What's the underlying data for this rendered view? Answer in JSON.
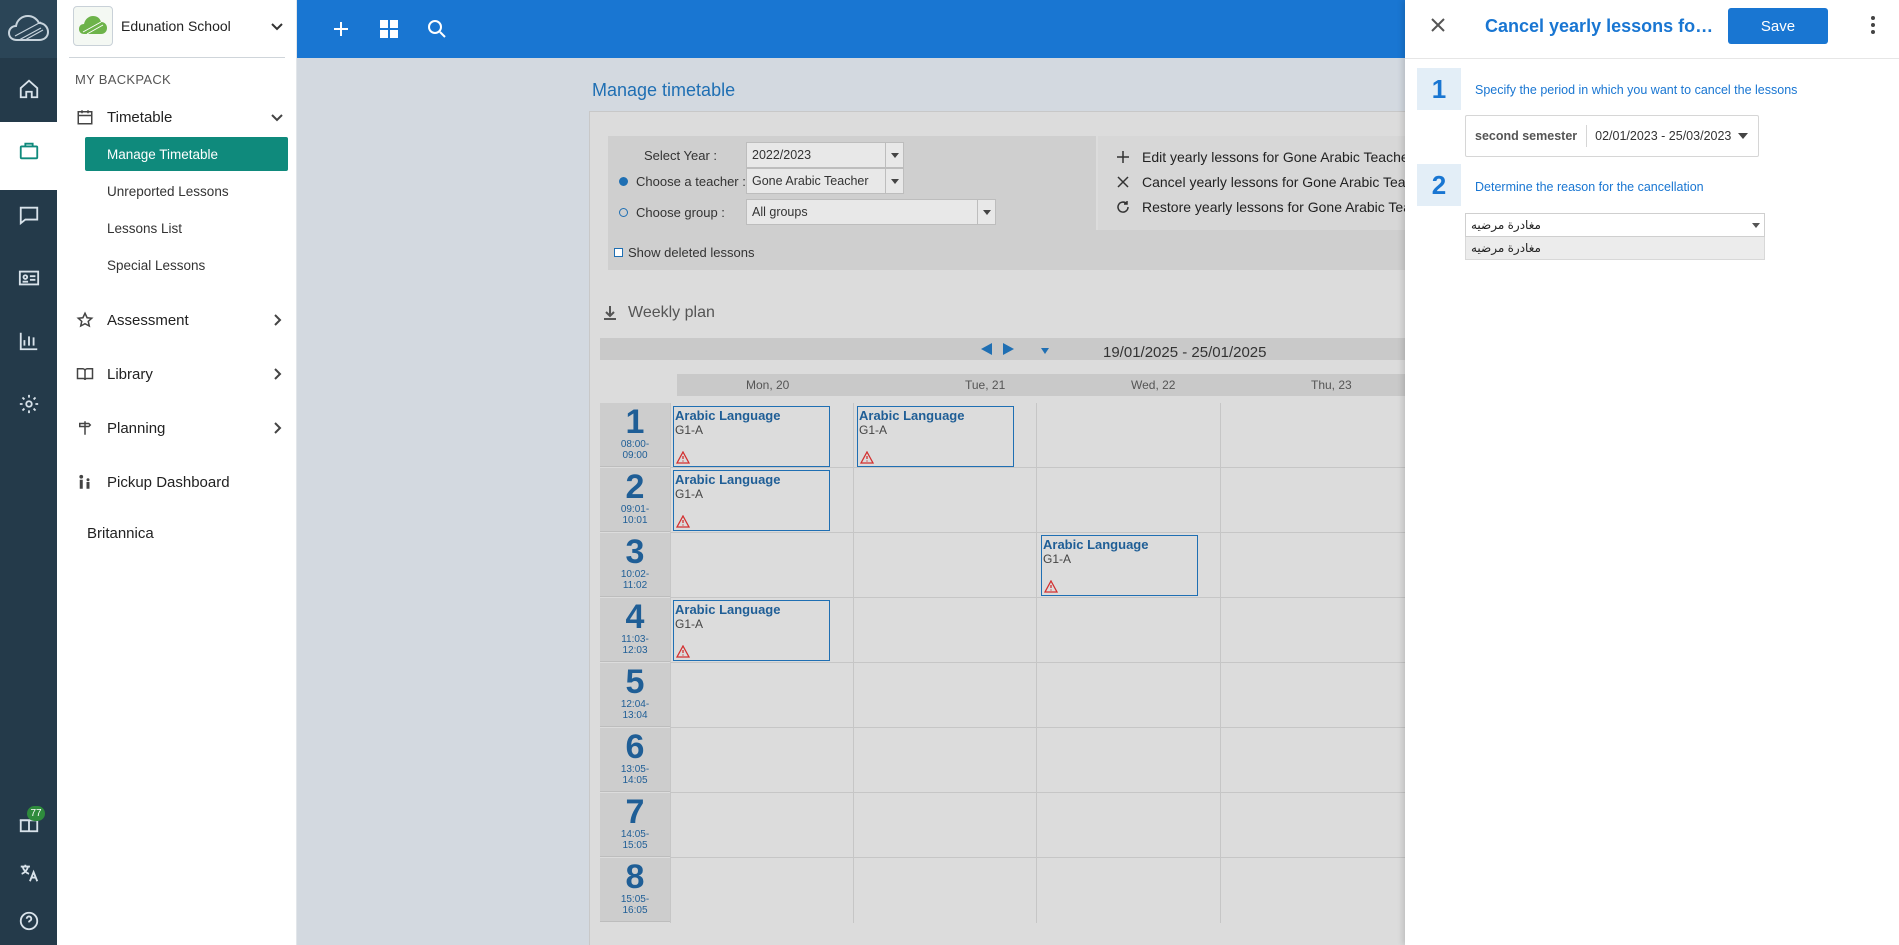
{
  "sidebar": {
    "school_name": "Edunation School",
    "section_header": "MY BACKPACK",
    "timetable_label": "Timetable",
    "sub_items": [
      "Manage Timetable",
      "Unreported Lessons",
      "Lessons List",
      "Special Lessons"
    ],
    "assessment_label": "Assessment",
    "library_label": "Library",
    "planning_label": "Planning",
    "pickup_label": "Pickup Dashboard",
    "britannica_label": "Britannica"
  },
  "rail": {
    "gift_badge": "77"
  },
  "main": {
    "page_title": "Manage timetable",
    "filters": {
      "year_label": "Select Year :",
      "year_value": "2022/2023",
      "teacher_label": "Choose a teacher :",
      "teacher_value": "Gone Arabic Teacher",
      "group_label": "Choose group :",
      "group_value": "All groups",
      "show_deleted": "Show deleted lessons"
    },
    "actions": [
      "Edit yearly lessons for Gone Arabic Teacher",
      "Cancel yearly lessons for Gone Arabic Teacher",
      "Restore yearly lessons for Gone Arabic Teacher"
    ],
    "weekly_plan_title": "Weekly plan",
    "date_range": "19/01/2025 - 25/01/2025",
    "days": [
      "Mon, 20",
      "Tue, 21",
      "Wed, 22",
      "Thu, 23"
    ],
    "slots": [
      {
        "num": "1",
        "start": "08:00-",
        "end": "09:00"
      },
      {
        "num": "2",
        "start": "09:01-",
        "end": "10:01"
      },
      {
        "num": "3",
        "start": "10:02-",
        "end": "11:02"
      },
      {
        "num": "4",
        "start": "11:03-",
        "end": "12:03"
      },
      {
        "num": "5",
        "start": "12:04-",
        "end": "13:04"
      },
      {
        "num": "6",
        "start": "13:05-",
        "end": "14:05"
      },
      {
        "num": "7",
        "start": "14:05-",
        "end": "15:05"
      },
      {
        "num": "8",
        "start": "15:05-",
        "end": "16:05"
      }
    ],
    "lessons": [
      {
        "name": "Arabic Language",
        "group": "G1-A",
        "day": "Mon, 20",
        "slot": "1"
      },
      {
        "name": "Arabic Language",
        "group": "G1-A",
        "day": "Tue, 21",
        "slot": "1"
      },
      {
        "name": "Arabic Language",
        "group": "G1-A",
        "day": "Mon, 20",
        "slot": "2"
      },
      {
        "name": "Arabic Language",
        "group": "G1-A",
        "day": "Wed, 22",
        "slot": "3"
      },
      {
        "name": "Arabic Language",
        "group": "G1-A",
        "day": "Mon, 20",
        "slot": "4"
      }
    ]
  },
  "panel": {
    "title": "Cancel yearly lessons for ...",
    "save_label": "Save",
    "step1_num": "1",
    "step1_label": "Specify the period in which you want to cancel the lessons",
    "period_label": "second semester",
    "period_value": "02/01/2023 - 25/03/2023",
    "step2_num": "2",
    "step2_label": "Determine the reason for the cancellation",
    "reason_value": "مغادرة مرضيه",
    "reason_option": "مغادرة مرضيه"
  },
  "colors": {
    "primary": "#1976d2",
    "accent_teal": "#0f8a7c",
    "rail": "#243a4a",
    "warning": "#d32f2f"
  }
}
